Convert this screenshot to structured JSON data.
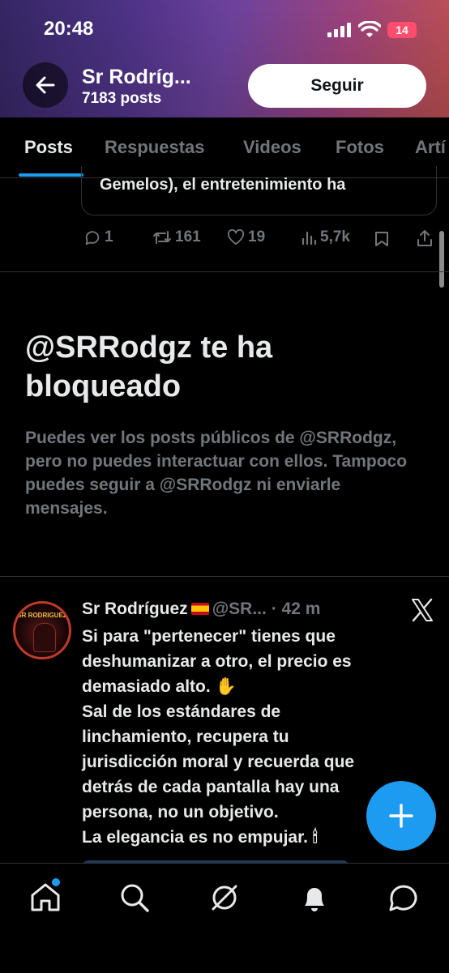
{
  "status_bar": {
    "time": "20:48",
    "battery": "14"
  },
  "header": {
    "profile_name": "Sr Rodríg...",
    "post_count": "7183 posts",
    "follow_label": "Seguir"
  },
  "tabs": [
    {
      "label": "Posts",
      "active": true
    },
    {
      "label": "Respuestas",
      "active": false
    },
    {
      "label": "Videos",
      "active": false
    },
    {
      "label": "Fotos",
      "active": false
    },
    {
      "label": "Artí",
      "active": false
    }
  ],
  "previous_post": {
    "quoted_text": "Gemelos), el entretenimiento ha",
    "replies": "1",
    "reposts": "161",
    "likes": "19",
    "views": "5,7k"
  },
  "blocked_notice": {
    "title": "@SRRodgz te ha bloqueado",
    "description": "Puedes ver los posts públicos de @SRRodgz, pero no puedes interactuar con ellos. Tampoco puedes seguir a @SRRodgz ni enviarle mensajes."
  },
  "tweet": {
    "author_name": "Sr Rodríguez",
    "handle": "@SR...",
    "time": "· 42 m",
    "avatar_text": "SR RODRIGUEZ",
    "lines": [
      "Si para \"pertenecer\" tienes que",
      "deshumanizar a otro, el precio es",
      "demasiado alto.",
      "Sal de los estándares de",
      "linchamiento, recupera tu",
      "jurisdicción moral y recuerda que",
      "detrás de cada pantalla hay una",
      "persona, no un objetivo.",
      "La elegancia es no empujar."
    ],
    "emoji_hand": "✋",
    "emoji_candle": "🕯"
  },
  "bottom_nav": {
    "items": [
      "home-icon",
      "search-icon",
      "grok-icon",
      "notifications-icon",
      "messages-icon"
    ]
  },
  "colors": {
    "accent": "#1d9bf0",
    "background": "#000000",
    "text_primary": "#e7e9ea",
    "text_secondary": "#71767b",
    "border": "#2f3336"
  }
}
